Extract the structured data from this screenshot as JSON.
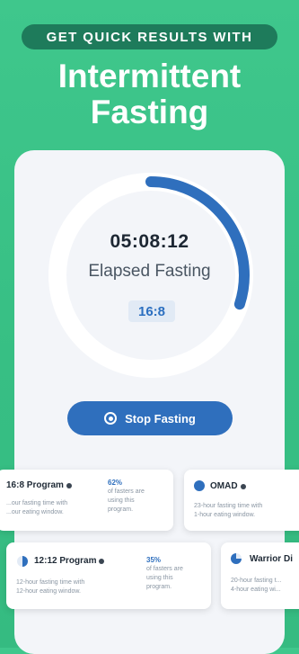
{
  "header": {
    "tagline": "GET QUICK RESULTS WITH",
    "title_line1": "Intermittent",
    "title_line2": "Fasting"
  },
  "timer": {
    "time": "05:08:12",
    "label": "Elapsed Fasting",
    "plan_badge": "16:8",
    "progress_fraction": 0.3
  },
  "actions": {
    "stop_label": "Stop Fasting"
  },
  "programs": [
    {
      "title": "16:8 Program",
      "desc_line1": "...our fasting time with",
      "desc_line2": "...our eating window.",
      "pct": "62%",
      "stat_line1": "of fasters are",
      "stat_line2": "using this",
      "stat_line3": "program."
    },
    {
      "title": "OMAD",
      "desc_line1": "23-hour fasting time with",
      "desc_line2": "1-hour eating window."
    },
    {
      "title": "12:12 Program",
      "desc_line1": "12-hour fasting time with",
      "desc_line2": "12-hour eating window.",
      "pct": "35%",
      "stat_line1": "of fasters are",
      "stat_line2": "using this",
      "stat_line3": "program."
    },
    {
      "title": "Warrior Di",
      "desc_line1": "20-hour fasting t...",
      "desc_line2": "4-hour eating wi..."
    }
  ],
  "colors": {
    "background": "#3fc78c",
    "pill": "#1e7b5b",
    "accent": "#2f6fbd"
  }
}
